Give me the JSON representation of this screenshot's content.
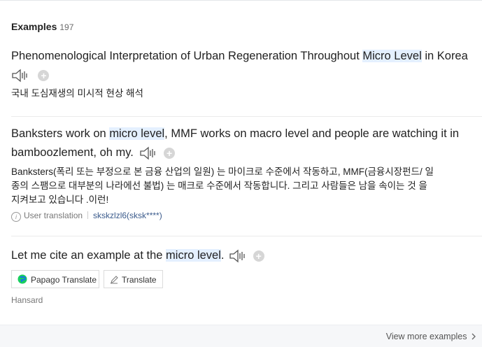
{
  "header": {
    "title": "Examples",
    "count": "197"
  },
  "examples": [
    {
      "sentence_pre": "Phenomenological Interpretation of Urban Regeneration Throughout ",
      "sentence_hl": "Micro Level",
      "sentence_post": " in Korea",
      "translation": "국내 도심재생의 미시적 현상 해석"
    },
    {
      "sentence_pre": "Banksters work on ",
      "sentence_hl": "micro level",
      "sentence_post_line1": ", MMF works on macro level and people are watching it in",
      "sentence_line2": "bamboozlement, oh my.",
      "translation_line1": "Banksters(폭리 또는 부정으로 본 금융 산업의 일원) 는 마이크로 수준에서 작동하고, MMF(금융시장펀드/ 일",
      "translation_line2": "종의 스팸으로 대부분의 나라에선 불법) 는 매크로 수준에서 작동합니다. 그리고 사람들은 남을 속이는 것 을",
      "translation_line3": "지켜보고 있습니다 .이런!",
      "meta_label": "User translation",
      "meta_user": "skskzlzl6(sksk****)"
    },
    {
      "sentence_pre": "Let me cite an example at the ",
      "sentence_hl": "micro level",
      "sentence_post": ".",
      "papago_label": "Papago Translate",
      "translate_label": "Translate",
      "source": "Hansard"
    }
  ],
  "footer": {
    "more_label": "View more examples"
  },
  "colors": {
    "highlight": "#e4f0ff",
    "link": "#3b5b8c",
    "papago_green": "#19ce60",
    "papago_blue": "#1a73e8"
  }
}
